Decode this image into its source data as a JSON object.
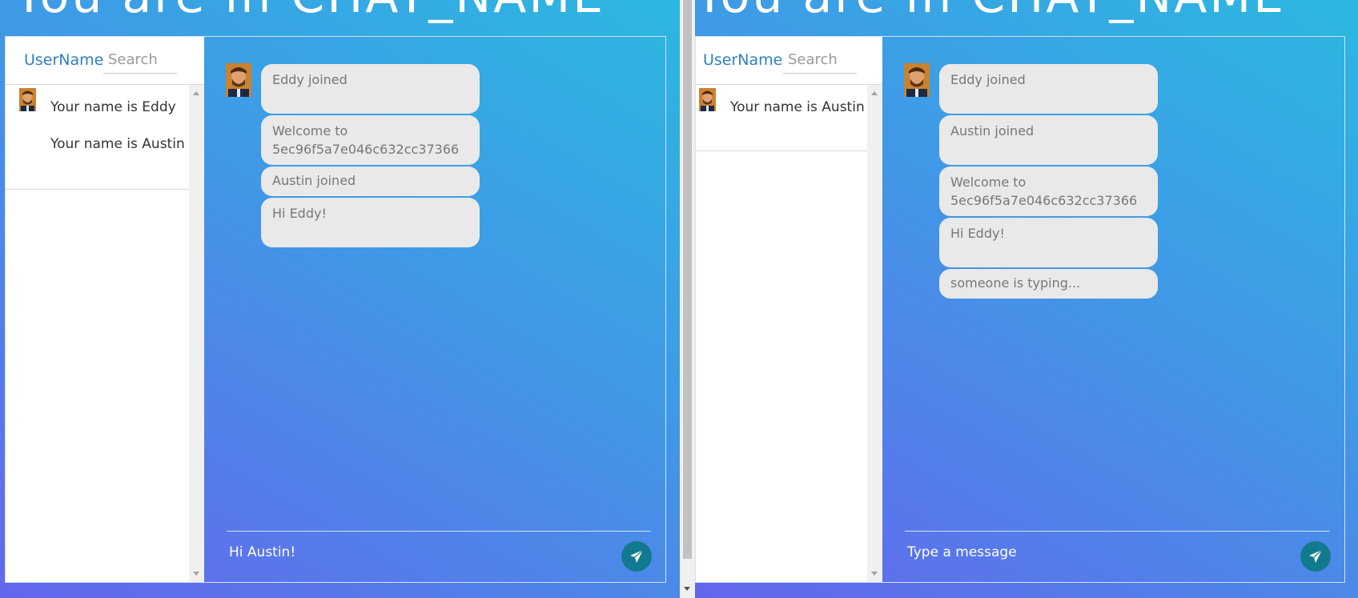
{
  "room_title": "You are in CHAT_NAME",
  "left": {
    "sidebar": {
      "username_label": "UserName",
      "search_placeholder": "Search",
      "users": [
        "Your name is Eddy",
        "Your name is Austin"
      ]
    },
    "messages": [
      "Eddy joined",
      "Welcome to 5ec96f5a7e046c632cc37366",
      "Austin joined",
      "Hi Eddy!"
    ],
    "input_value": "Hi Austin!",
    "input_placeholder": "Type a message"
  },
  "right": {
    "sidebar": {
      "username_label": "UserName",
      "search_placeholder": "Search",
      "users": [
        "Your name is Austin"
      ]
    },
    "messages": [
      "Eddy joined",
      "Austin joined",
      "Welcome to 5ec96f5a7e046c632cc37366",
      "Hi Eddy!",
      "someone is typing..."
    ],
    "input_value": "",
    "input_placeholder": "Type a message"
  },
  "icons": {
    "send": "paper-plane-icon",
    "avatar": "user-avatar-photo"
  },
  "colors": {
    "send_button": "#127a8f",
    "bubble": "#e9e9e9",
    "accent": "#2f7fc1"
  }
}
